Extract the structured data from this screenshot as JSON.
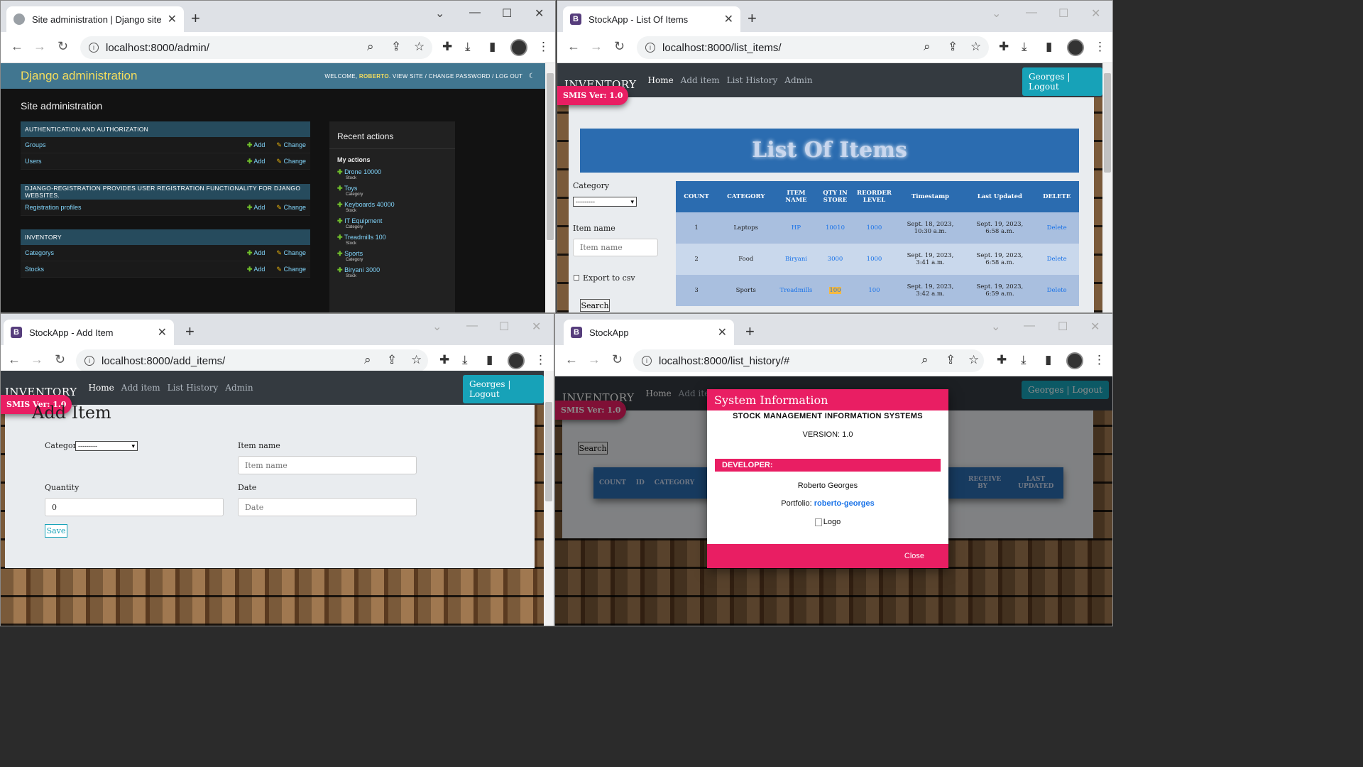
{
  "win1": {
    "tab_title": "Site administration | Django site",
    "url": "localhost:8000/admin/",
    "admin": {
      "brand": "Django administration",
      "welcome": "WELCOME,",
      "user": "ROBERTO",
      "user_links": ". VIEW SITE / CHANGE PASSWORD / LOG OUT",
      "title": "Site administration",
      "modules": [
        {
          "caption": "AUTHENTICATION AND AUTHORIZATION",
          "rows": [
            "Groups",
            "Users"
          ]
        },
        {
          "caption": "DJANGO-REGISTRATION PROVIDES USER REGISTRATION FUNCTIONALITY FOR DJANGO WEBSITES.",
          "rows": [
            "Registration profiles"
          ]
        },
        {
          "caption": "INVENTORY",
          "rows": [
            "Categorys",
            "Stocks"
          ]
        }
      ],
      "add_label": "Add",
      "change_label": "Change",
      "recent_title": "Recent actions",
      "my_actions": "My actions",
      "actions": [
        {
          "title": "Drone 10000",
          "type": "Stock"
        },
        {
          "title": "Toys",
          "type": "Category"
        },
        {
          "title": "Keyboards 40000",
          "type": "Stock"
        },
        {
          "title": "IT Equipment",
          "type": "Category"
        },
        {
          "title": "Treadmills 100",
          "type": "Stock"
        },
        {
          "title": "Sports",
          "type": "Category"
        },
        {
          "title": "Biryani 3000",
          "type": "Stock"
        }
      ]
    }
  },
  "win2": {
    "tab_title": "StockApp - List Of Items",
    "url": "localhost:8000/list_items/",
    "heading": "List Of Items",
    "category_label": "Category",
    "select_default": "---------",
    "item_name_label": "Item name",
    "item_name_placeholder": "Item name",
    "export_label": "Export to csv",
    "search_label": "Search",
    "columns": [
      "COUNT",
      "CATEGORY",
      "ITEM NAME",
      "QTY IN STORE",
      "REORDER LEVEL",
      "Timestamp",
      "Last Updated",
      "DELETE"
    ],
    "rows": [
      {
        "count": "1",
        "category": "Laptops",
        "item": "HP",
        "qty": "10010",
        "reorder": "1000",
        "ts1": "Sept. 18, 2023,",
        "ts2": "10:30 a.m.",
        "lu1": "Sept. 19, 2023,",
        "lu2": "6:58 a.m.",
        "del": "Delete"
      },
      {
        "count": "2",
        "category": "Food",
        "item": "Biryani",
        "qty": "3000",
        "reorder": "1000",
        "ts1": "Sept. 19, 2023,",
        "ts2": "3:41 a.m.",
        "lu1": "Sept. 19, 2023,",
        "lu2": "6:58 a.m.",
        "del": "Delete"
      },
      {
        "count": "3",
        "category": "Sports",
        "item": "Treadmills",
        "qty": "100",
        "reorder": "100",
        "ts1": "Sept. 19, 2023,",
        "ts2": "3:42 a.m.",
        "lu1": "Sept. 19, 2023,",
        "lu2": "6:59 a.m.",
        "del": "Delete"
      }
    ]
  },
  "win3": {
    "tab_title": "StockApp - Add Item",
    "url": "localhost:8000/add_items/",
    "heading": "Add Item",
    "category_label": "Category",
    "select_default": "---------",
    "item_name_label": "Item name",
    "item_name_placeholder": "Item name",
    "quantity_label": "Quantity",
    "quantity_value": "0",
    "date_label": "Date",
    "date_placeholder": "Date",
    "save_label": "Save"
  },
  "win4": {
    "tab_title": "StockApp",
    "url": "localhost:8000/list_history/#",
    "search_label": "Search",
    "columns": [
      "COUNT",
      "ID",
      "CATEGORY",
      "RECEIVE BY",
      "LAST UPDATED"
    ],
    "modal": {
      "title": "System Information",
      "system": "STOCK MANAGEMENT INFORMATION SYSTEMS",
      "version": "VERSION: 1.0",
      "developer_label": "DEVELOPER:",
      "developer": "Roberto Georges",
      "portfolio_label": "Portfolio:",
      "portfolio_link": "roberto-georges",
      "logo_alt": "Logo",
      "close_label": "Close"
    }
  },
  "shared": {
    "brand": "INVENTORY",
    "nav": [
      "Home",
      "Add item",
      "List History",
      "Admin"
    ],
    "logout": "Georges | Logout",
    "version_badge": "SMIS Ver: 1.0"
  }
}
